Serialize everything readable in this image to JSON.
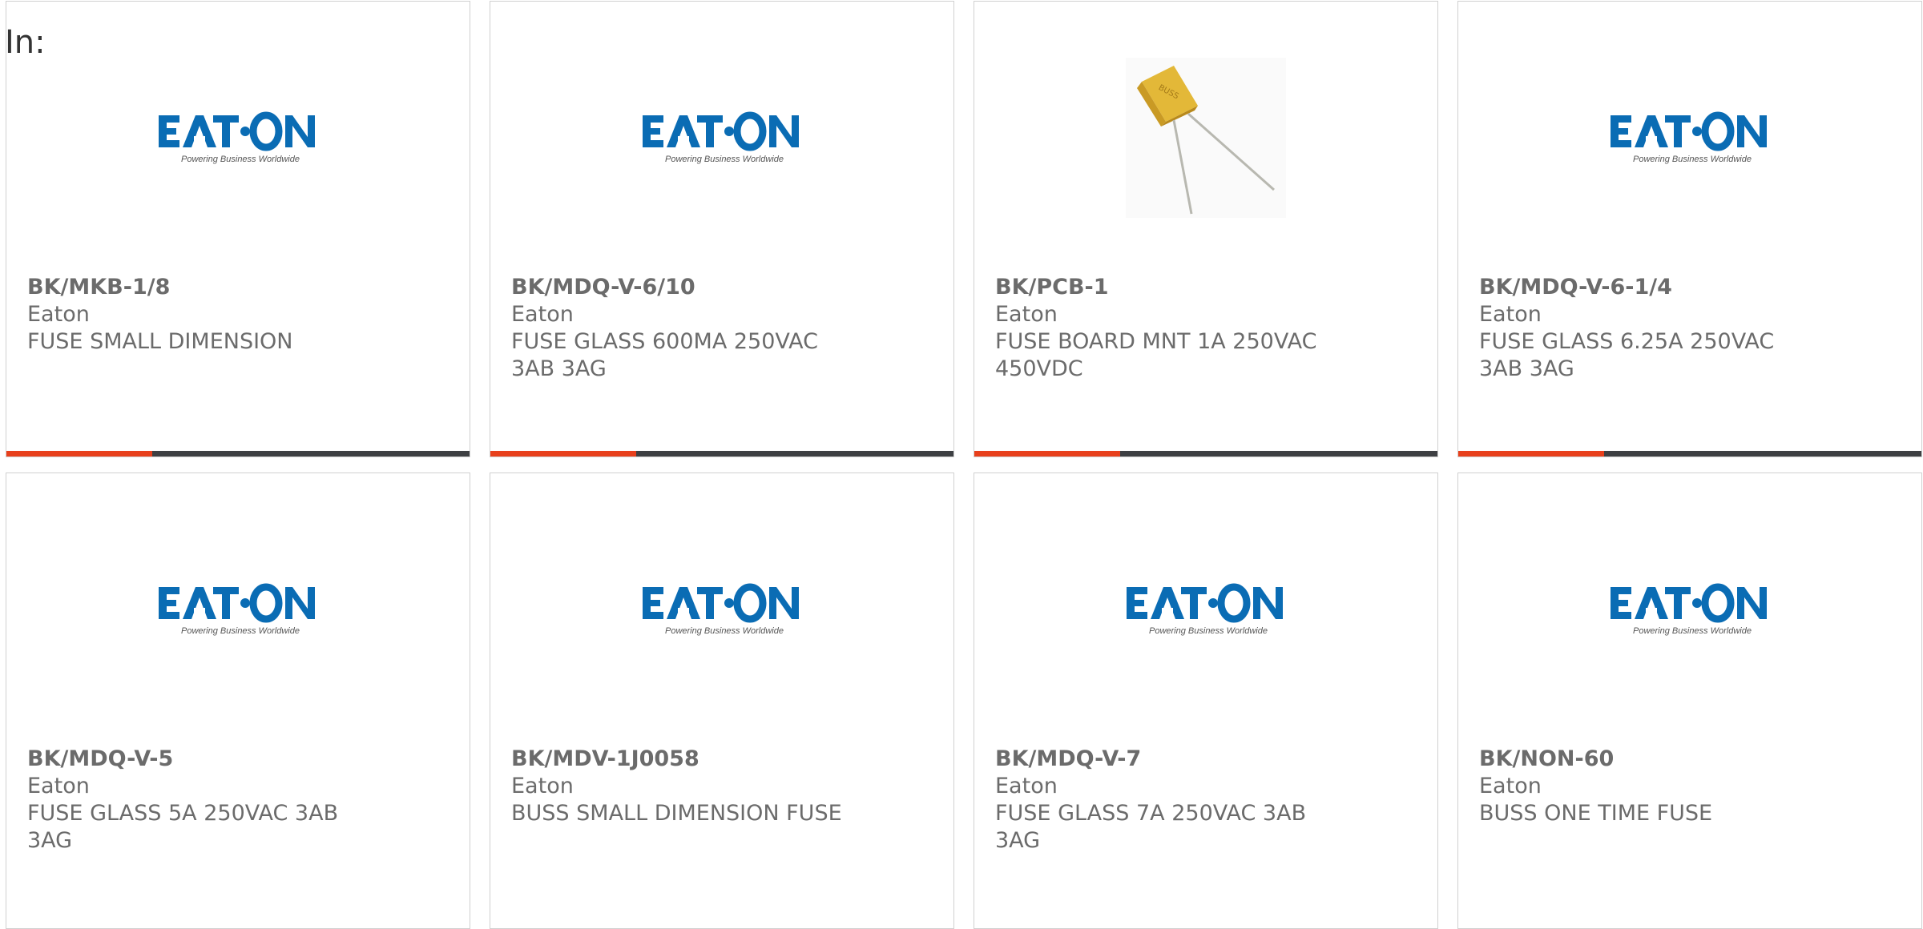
{
  "header": {
    "label": "In:"
  },
  "colors": {
    "accent": "#e8401c",
    "bar": "#3e4043",
    "eaton_blue": "#0a6cb4"
  },
  "products": [
    {
      "part_number": "BK/MKB-1/8",
      "manufacturer": "Eaton",
      "description": "FUSE SMALL DIMENSION",
      "image": "eaton-logo",
      "show_bar": true
    },
    {
      "part_number": "BK/MDQ-V-6/10",
      "manufacturer": "Eaton",
      "description": "FUSE GLASS 600MA 250VAC 3AB 3AG",
      "image": "eaton-logo",
      "show_bar": true
    },
    {
      "part_number": "BK/PCB-1",
      "manufacturer": "Eaton",
      "description": "FUSE BOARD MNT 1A 250VAC 450VDC",
      "image": "fuse-component-photo",
      "show_bar": true
    },
    {
      "part_number": "BK/MDQ-V-6-1/4",
      "manufacturer": "Eaton",
      "description": "FUSE GLASS 6.25A 250VAC 3AB 3AG",
      "image": "eaton-logo",
      "show_bar": true
    },
    {
      "part_number": "BK/MDQ-V-5",
      "manufacturer": "Eaton",
      "description": "FUSE GLASS 5A 250VAC 3AB 3AG",
      "image": "eaton-logo",
      "show_bar": false
    },
    {
      "part_number": "BK/MDV-1J0058",
      "manufacturer": "Eaton",
      "description": "BUSS SMALL DIMENSION FUSE",
      "image": "eaton-logo",
      "show_bar": false
    },
    {
      "part_number": "BK/MDQ-V-7",
      "manufacturer": "Eaton",
      "description": "FUSE GLASS 7A 250VAC 3AB 3AG",
      "image": "eaton-logo",
      "show_bar": false
    },
    {
      "part_number": "BK/NON-60",
      "manufacturer": "Eaton",
      "description": "BUSS ONE TIME FUSE",
      "image": "eaton-logo",
      "show_bar": false
    }
  ],
  "logo": {
    "wordmark": "EATON",
    "tagline": "Powering Business Worldwide"
  }
}
